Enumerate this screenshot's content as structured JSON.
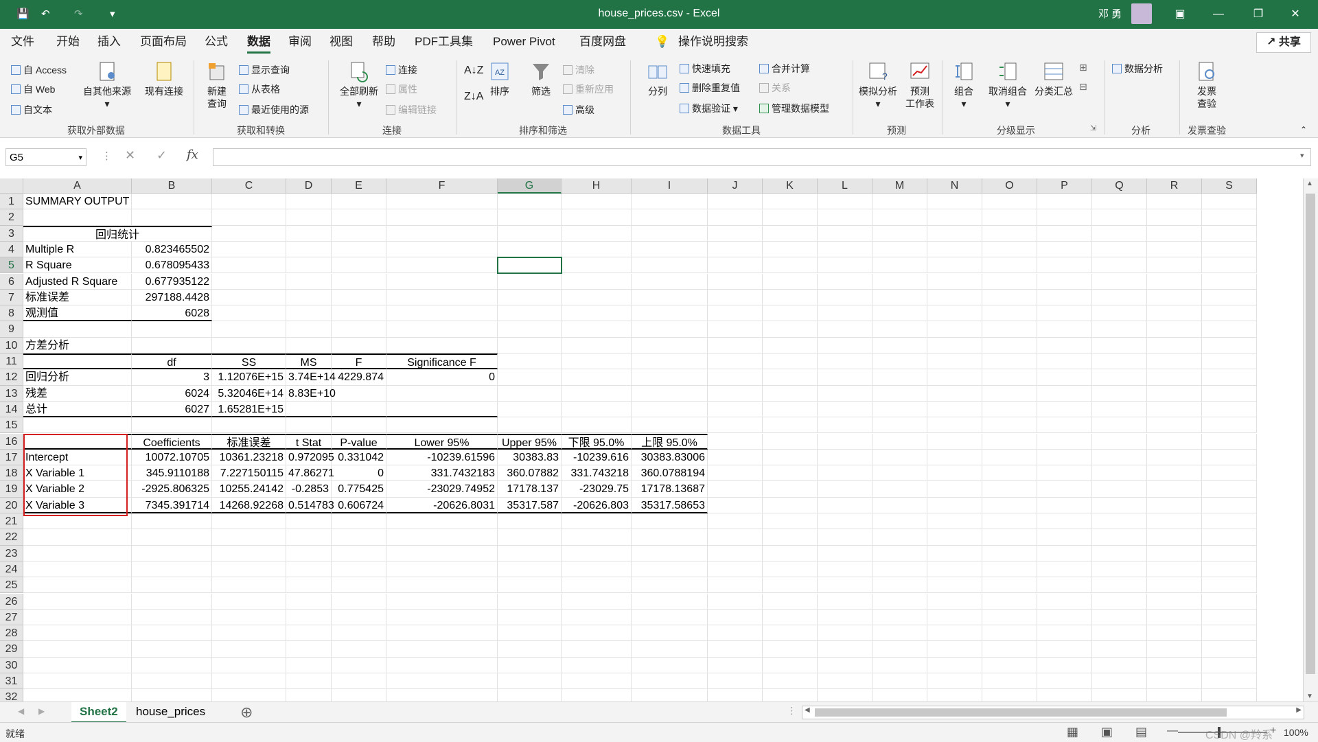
{
  "window": {
    "title": "house_prices.csv  -  Excel",
    "user": "邓 勇",
    "minimize": "—",
    "restore": "❐",
    "close": "✕"
  },
  "menu": {
    "items": [
      "文件",
      "开始",
      "插入",
      "页面布局",
      "公式",
      "数据",
      "审阅",
      "视图",
      "帮助",
      "PDF工具集",
      "Power Pivot",
      "百度网盘"
    ],
    "active": "数据",
    "search": "操作说明搜索",
    "share": "共享"
  },
  "ribbon": {
    "get_external": {
      "access": "自 Access",
      "web": "自 Web",
      "text": "自文本",
      "other": "自其他来源",
      "existing": "现有连接",
      "label": "获取外部数据"
    },
    "transform": {
      "new_query": "新建",
      "new_query2": "查询",
      "show_queries": "显示查询",
      "from_table": "从表格",
      "recent": "最近使用的源",
      "label": "获取和转换"
    },
    "connections": {
      "refresh": "全部刷新",
      "conn": "连接",
      "props": "属性",
      "edit_links": "编辑链接",
      "label": "连接"
    },
    "sort_filter": {
      "sort": "排序",
      "filter": "筛选",
      "clear": "清除",
      "reapply": "重新应用",
      "advanced": "高级",
      "label": "排序和筛选"
    },
    "data_tools": {
      "split": "分列",
      "flash": "快速填充",
      "remove_dup": "删除重复值",
      "validate": "数据验证",
      "consolidate": "合并计算",
      "relations": "关系",
      "manage_model": "管理数据模型",
      "label": "数据工具"
    },
    "forecast": {
      "whatif": "模拟分析",
      "sheet1": "预测",
      "sheet2": "工作表",
      "label": "预测"
    },
    "outline": {
      "group": "组合",
      "ungroup": "取消组合",
      "subtotal": "分类汇总",
      "label": "分级显示"
    },
    "analysis": {
      "data_analysis": "数据分析",
      "label": "分析"
    },
    "invoice": {
      "check1": "发票",
      "check2": "查验",
      "label": "发票查验"
    }
  },
  "formula_bar": {
    "name_box": "G5",
    "fx": "fx",
    "value": ""
  },
  "grid": {
    "columns": [
      "A",
      "B",
      "C",
      "D",
      "E",
      "F",
      "G",
      "H",
      "I",
      "J",
      "K",
      "L",
      "M",
      "N",
      "O",
      "P",
      "Q",
      "R",
      "S"
    ],
    "selected_column": "G",
    "selected_row": 5,
    "rows": [
      1,
      2,
      3,
      4,
      5,
      6,
      7,
      8,
      9,
      10,
      11,
      12,
      13,
      14,
      15,
      16,
      17,
      18,
      19,
      20,
      21,
      22,
      23,
      24,
      25,
      26,
      27,
      28,
      29,
      30,
      31,
      32
    ]
  },
  "cells": {
    "A1": "SUMMARY OUTPUT",
    "A3": "回归统计",
    "A4": "Multiple R",
    "B4": "0.823465502",
    "A5": "R Square",
    "B5": "0.678095433",
    "A6": "Adjusted R Square",
    "B6": "0.677935122",
    "A7": "标准误差",
    "B7": "297188.4428",
    "A8": "观测值",
    "B8": "6028",
    "A10": "方差分析",
    "B11": "df",
    "C11": "SS",
    "D11": "MS",
    "E11": "F",
    "F11": "Significance F",
    "A12": "回归分析",
    "B12": "3",
    "C12": "1.12076E+15",
    "D12": "3.74E+14",
    "E12": "4229.874",
    "F12": "0",
    "A13": "残差",
    "B13": "6024",
    "C13": "5.32046E+14",
    "D13": "8.83E+10",
    "A14": "总计",
    "B14": "6027",
    "C14": "1.65281E+15",
    "B16": "Coefficients",
    "C16": "标准误差",
    "D16": "t Stat",
    "E16": "P-value",
    "F16": "Lower 95%",
    "G16": "Upper 95%",
    "H16": "下限 95.0%",
    "I16": "上限 95.0%",
    "A17": "Intercept",
    "B17": "10072.10705",
    "C17": "10361.23218",
    "D17": "0.972095",
    "E17": "0.331042",
    "F17": "-10239.61596",
    "G17": "30383.83",
    "H17": "-10239.616",
    "I17": "30383.83006",
    "A18": "X Variable 1",
    "B18": "345.9110188",
    "C18": "7.227150115",
    "D18": "47.86271",
    "E18": "0",
    "F18": "331.7432183",
    "G18": "360.07882",
    "H18": "331.743218",
    "I18": "360.0788194",
    "A19": "X Variable 2",
    "B19": "-2925.806325",
    "C19": "10255.24142",
    "D19": "-0.2853",
    "E19": "0.775425",
    "F19": "-23029.74952",
    "G19": "17178.137",
    "H19": "-23029.75",
    "I19": "17178.13687",
    "A20": "X Variable 3",
    "B20": "7345.391714",
    "C20": "14268.92268",
    "D20": "0.514783",
    "E20": "0.606724",
    "F20": "-20626.8031",
    "G20": "35317.587",
    "H20": "-20626.803",
    "I20": "35317.58653"
  },
  "sheets": {
    "tabs": [
      "Sheet2",
      "house_prices"
    ],
    "active": "Sheet2",
    "add": "⊕"
  },
  "status": {
    "ready": "就绪",
    "zoom": "100%"
  },
  "watermark": "CSDN @羚系",
  "colors": {
    "excel_green": "#217346",
    "highlight_red": "#d42020"
  }
}
